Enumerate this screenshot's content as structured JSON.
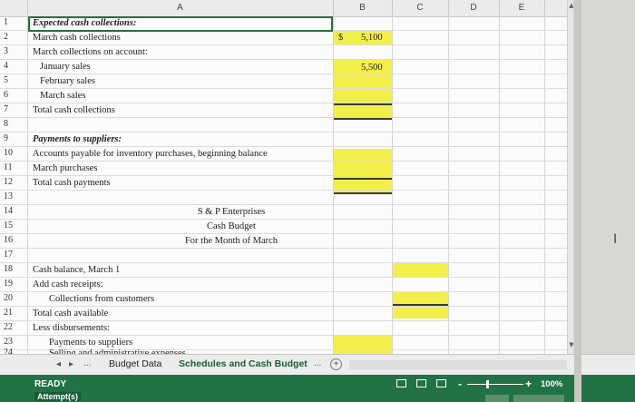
{
  "columns": [
    "A",
    "B",
    "C",
    "D",
    "E"
  ],
  "rows": [
    {
      "n": "1",
      "label": "Expected cash collections:",
      "style": "bi"
    },
    {
      "n": "2",
      "label": "March cash collections",
      "dollar": "$",
      "value": "5,100"
    },
    {
      "n": "3",
      "label": "March collections on account:"
    },
    {
      "n": "4",
      "label": "January sales",
      "indent": 1
    },
    {
      "n": "5",
      "label": "February sales",
      "indent": 1,
      "value": "5,500"
    },
    {
      "n": "6",
      "label": "March sales",
      "indent": 1
    },
    {
      "n": "7",
      "label": "Total cash collections"
    },
    {
      "n": "8",
      "label": ""
    },
    {
      "n": "9",
      "label": "Payments to suppliers:",
      "style": "bi"
    },
    {
      "n": "10",
      "label": "Accounts payable for inventory purchases, beginning balance"
    },
    {
      "n": "11",
      "label": "March purchases"
    },
    {
      "n": "12",
      "label": "Total cash payments"
    },
    {
      "n": "13",
      "label": ""
    },
    {
      "n": "14",
      "label": "S & P Enterprises",
      "style": "center"
    },
    {
      "n": "15",
      "label": "Cash Budget",
      "style": "center"
    },
    {
      "n": "16",
      "label": "For the Month of March",
      "style": "center"
    },
    {
      "n": "17",
      "label": ""
    },
    {
      "n": "18",
      "label": "Cash balance, March 1"
    },
    {
      "n": "19",
      "label": "Add cash receipts:"
    },
    {
      "n": "20",
      "label": "Collections from customers",
      "indent": 2
    },
    {
      "n": "21",
      "label": "Total cash available"
    },
    {
      "n": "22",
      "label": "Less disbursements:"
    },
    {
      "n": "23",
      "label": "Payments to suppliers",
      "indent": 2
    },
    {
      "n": "24",
      "label": "Selling and administrative expenses",
      "indent": 2
    }
  ],
  "tabs": {
    "prev": "◂",
    "next": "▸",
    "more": "...",
    "budget_data": "Budget Data",
    "schedules": "Schedules and Cash Budget",
    "more2": "...",
    "add": "+"
  },
  "status": {
    "ready": "READY",
    "attempts": "Attempt(s)",
    "zoom_minus": "-",
    "zoom_plus": "+",
    "zoom": "100%"
  },
  "colors": {
    "highlight": "#f3ef4a",
    "status_bar": "#217346",
    "selection": "#2b6b3f"
  }
}
